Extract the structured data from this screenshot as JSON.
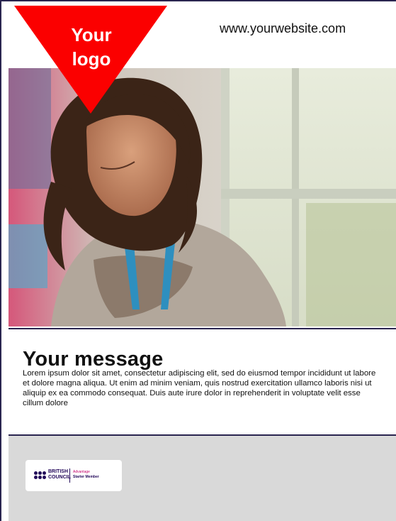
{
  "header": {
    "website": "www.yourwebsite.com",
    "logo_line1": "Your",
    "logo_line2": "logo"
  },
  "message": {
    "title": "Your message",
    "body": "Lorem ipsum dolor sit amet, consectetur adipiscing elit, sed do eiusmod tempor incididunt ut labore et dolore magna aliqua. Ut enim ad minim veniam, quis nostrud exercitation ullamco laboris nisi ut aliquip ex ea commodo consequat. Duis aute irure dolor in reprehenderit in voluptate velit esse cillum dolore"
  },
  "footer": {
    "badge_org_line1": "BRITISH",
    "badge_org_line2": "COUNCIL",
    "badge_level_line1": "Advantage",
    "badge_level_line2": "Starter Member"
  },
  "colors": {
    "logo_red": "#fb0000",
    "frame_navy": "#2a2550",
    "footer_grey": "#d9d9d9"
  }
}
